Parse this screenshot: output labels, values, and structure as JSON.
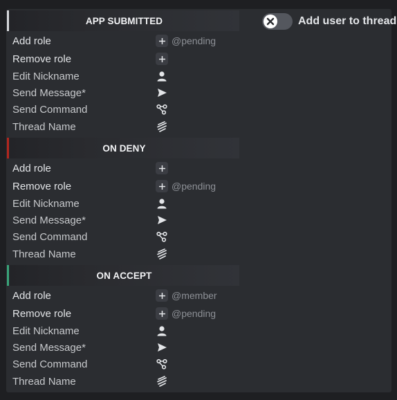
{
  "toggle": {
    "label": "Add user to thread",
    "enabled": false
  },
  "sections": [
    {
      "title": "APP SUBMITTED",
      "rows": [
        {
          "label": "Add role",
          "value": "@pending"
        },
        {
          "label": "Remove role",
          "value": ""
        },
        {
          "label": "Edit Nickname",
          "value": ""
        },
        {
          "label": "Send Message*",
          "value": ""
        },
        {
          "label": "Send Command",
          "value": ""
        },
        {
          "label": "Thread Name",
          "value": ""
        }
      ]
    },
    {
      "title": "ON DENY",
      "rows": [
        {
          "label": "Add role",
          "value": ""
        },
        {
          "label": "Remove role",
          "value": "@pending"
        },
        {
          "label": "Edit Nickname",
          "value": ""
        },
        {
          "label": "Send Message*",
          "value": ""
        },
        {
          "label": "Send Command",
          "value": ""
        },
        {
          "label": "Thread Name",
          "value": ""
        }
      ]
    },
    {
      "title": "ON ACCEPT",
      "rows": [
        {
          "label": "Add role",
          "value": "@member"
        },
        {
          "label": "Remove role",
          "value": "@pending"
        },
        {
          "label": "Edit Nickname",
          "value": ""
        },
        {
          "label": "Send Message*",
          "value": ""
        },
        {
          "label": "Send Command",
          "value": ""
        },
        {
          "label": "Thread Name",
          "value": ""
        }
      ]
    }
  ],
  "icons": {
    "add_role": "plus-icon",
    "remove_role": "plus-icon",
    "edit_nickname": "user-icon",
    "send_message": "send-arrow-icon",
    "send_command": "command-nodes-icon",
    "thread_name": "thread-icon",
    "toggle_knob": "x-icon"
  },
  "colors": {
    "background": "#1e1f22",
    "panel": "#2b2d31",
    "deny_accent": "#b3261e",
    "accept_accent": "#3aa57a"
  }
}
